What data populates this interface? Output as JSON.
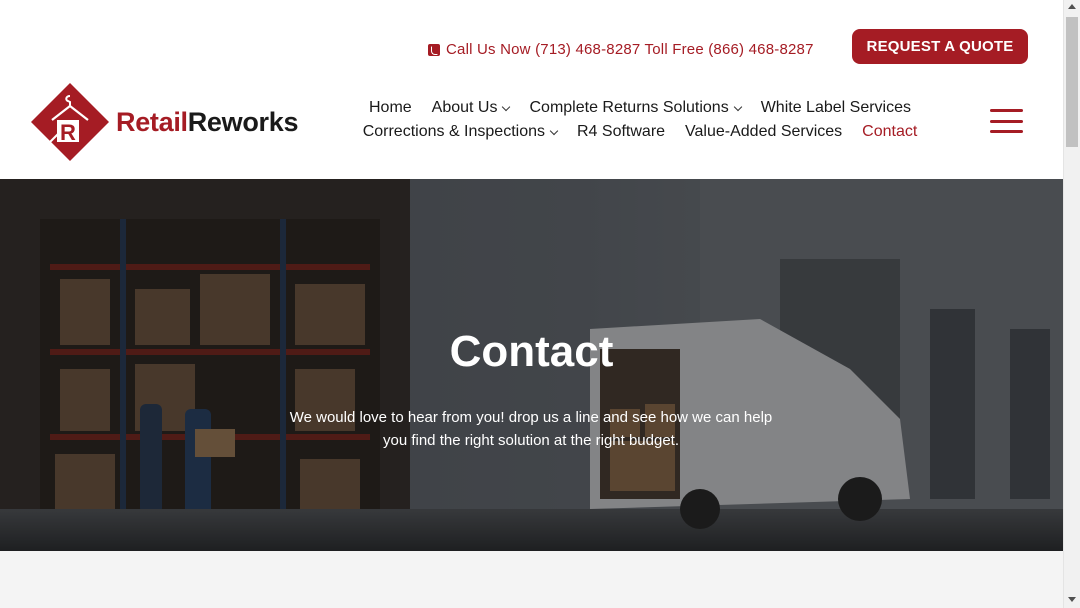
{
  "header": {
    "phone_text": "Call Us Now (713) 468-8287 Toll Free (866) 468-8287",
    "quote_button": "REQUEST A QUOTE",
    "logo": {
      "part1": "Retail",
      "part2": "Reworks"
    },
    "nav_row1": [
      {
        "label": "Home",
        "has_dropdown": false
      },
      {
        "label": "About Us",
        "has_dropdown": true
      },
      {
        "label": "Complete Returns Solutions",
        "has_dropdown": true
      },
      {
        "label": "White Label Services",
        "has_dropdown": false
      }
    ],
    "nav_row2": [
      {
        "label": "Corrections & Inspections",
        "has_dropdown": true
      },
      {
        "label": "R4 Software",
        "has_dropdown": false
      },
      {
        "label": "Value-Added Services",
        "has_dropdown": false
      },
      {
        "label": "Contact",
        "has_dropdown": false,
        "active": true
      }
    ]
  },
  "hero": {
    "title": "Contact",
    "subtitle_line1": "We would love to hear from you! drop us a line and see how we can help",
    "subtitle_line2": "you find the right solution at the right budget."
  },
  "colors": {
    "brand": "#a51c24",
    "text": "#1a1a1a",
    "section_bg": "#f4f4f4"
  },
  "icons": [
    "phone-icon",
    "chevron-down-icon",
    "hamburger-menu-icon",
    "scroll-up-arrow-icon",
    "scroll-down-arrow-icon"
  ]
}
